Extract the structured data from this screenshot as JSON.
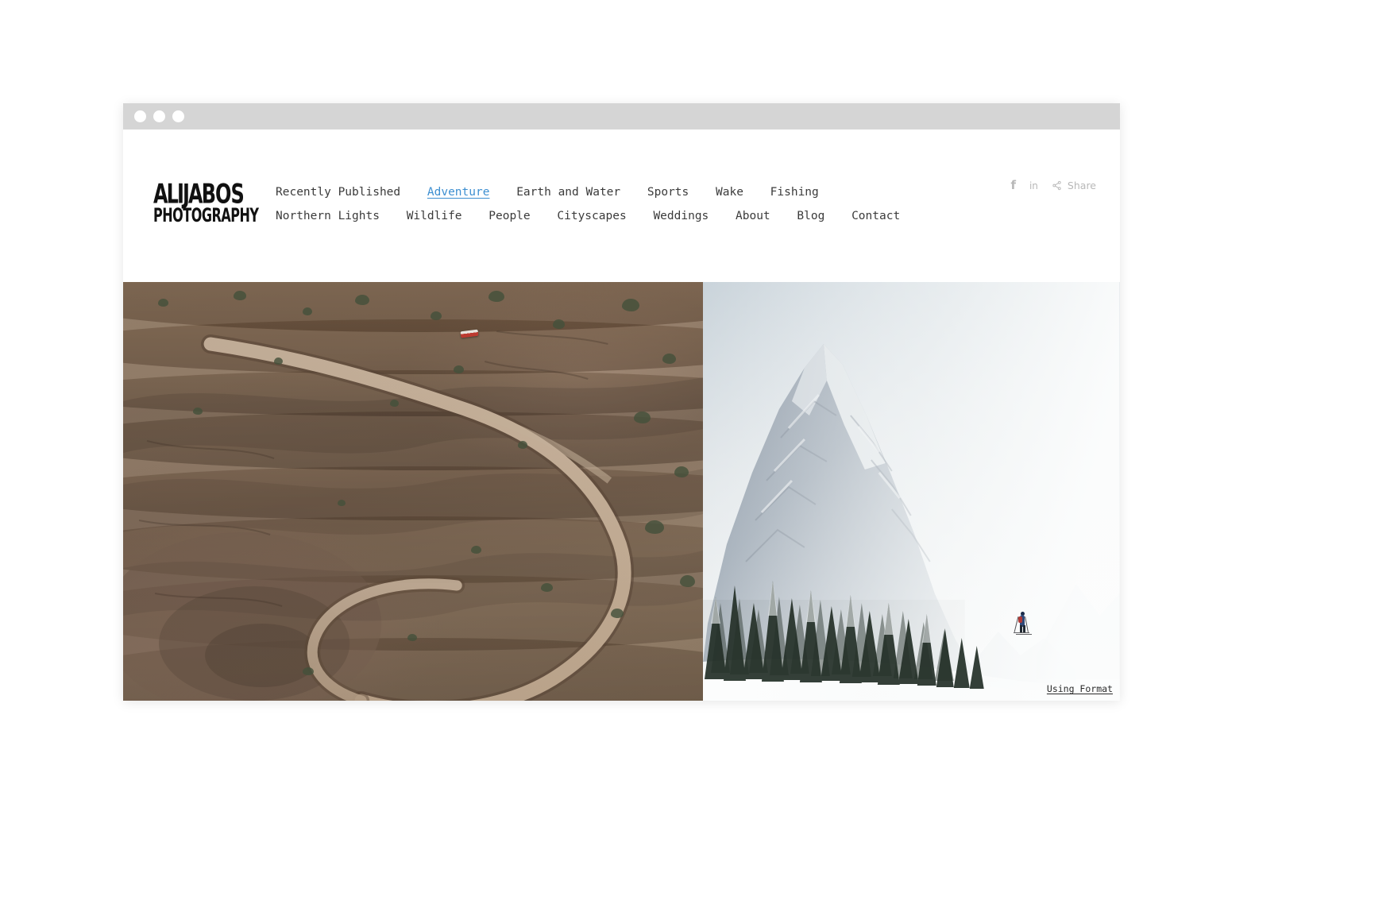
{
  "window": {
    "traffic_lights": [
      "close",
      "minimize",
      "zoom"
    ]
  },
  "brand": {
    "logo_line1_a": "ALIJA",
    "logo_line1_b": "BOS",
    "logo_line2": "PHOTOGRAPHY"
  },
  "nav": {
    "items": [
      {
        "label": "Recently Published",
        "active": false
      },
      {
        "label": "Adventure",
        "active": true
      },
      {
        "label": "Earth and Water",
        "active": false
      },
      {
        "label": "Sports",
        "active": false
      },
      {
        "label": "Wake",
        "active": false
      },
      {
        "label": "Fishing",
        "active": false
      },
      {
        "label": "Northern Lights",
        "active": false
      },
      {
        "label": "Wildlife",
        "active": false
      },
      {
        "label": "People",
        "active": false
      },
      {
        "label": "Cityscapes",
        "active": false
      },
      {
        "label": "Weddings",
        "active": false
      },
      {
        "label": "About",
        "active": false
      },
      {
        "label": "Blog",
        "active": false
      },
      {
        "label": "Contact",
        "active": false
      }
    ],
    "active_color": "#3d8fd1",
    "text_color": "#3b3b3b"
  },
  "share": {
    "facebook_label": "f",
    "linkedin_label": "in",
    "share_label": "Share",
    "icon_color": "#b8b8b8"
  },
  "gallery": {
    "items": [
      {
        "name": "canyon-switchback-road",
        "alt": "Aerial view of a red vehicle on a winding dirt switchback road carved into desert canyon rock"
      },
      {
        "name": "snowy-mountain-skier",
        "alt": "Cross-country skier crossing a snowfield below a snow-covered mountain and evergreen forest"
      }
    ]
  },
  "footer": {
    "using_format": "Using Format"
  }
}
